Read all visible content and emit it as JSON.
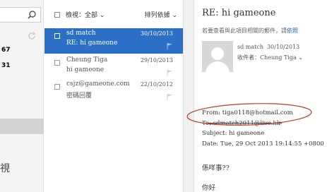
{
  "sidebar": {
    "search_icon": "search-icon",
    "refresh_icon": "refresh-icon",
    "count_1": "67",
    "count_2": "31",
    "big_text": "視"
  },
  "list": {
    "filter_label": "檢視：全部 ⌄",
    "sort_label": "排列依據 ⌄",
    "messages": [
      {
        "sender": "sd match",
        "date": "30/10/2013",
        "subject": "RE: hi gameone",
        "selected": true
      },
      {
        "sender": "Cheung Tiga",
        "date": "29/10/2013",
        "subject": "hi gameone",
        "selected": false
      },
      {
        "sender": "csjz@gameone.com",
        "date": "22/10/2012",
        "subject": "密碼回覆",
        "selected": false
      }
    ]
  },
  "reading": {
    "title": "RE: hi gameone",
    "notice": "若要查看與此項目相關的郵件，請",
    "notice_link": "依照",
    "from_name": "sd match",
    "from_date": "30/10/2013",
    "to_label": "收件者：Cheung Tiga ⌄",
    "from_header": "From: tiga0118@hotmail.com",
    "to_header": "To: sdmatch2011@live.hk",
    "subject_header": "Subject: hi gameone",
    "date_header": "Date: Tue, 29 Oct 2013 19:14:55 +0800",
    "body_line_1": "係咩事??",
    "body_line_2": "你好"
  },
  "colors": {
    "selected_row": "#2b6fc7",
    "annotation": "#c0392b",
    "link": "#1a5fb4"
  }
}
